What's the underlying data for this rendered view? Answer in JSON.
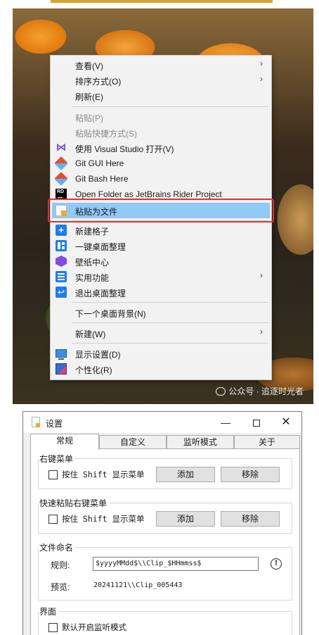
{
  "context_menu": {
    "items": [
      {
        "label": "查看(V)",
        "submenu": true
      },
      {
        "label": "排序方式(O)",
        "submenu": true
      },
      {
        "label": "刷新(E)"
      },
      {
        "label": "粘贴(P)",
        "disabled": true
      },
      {
        "label": "粘贴快捷方式(S)",
        "disabled": true
      },
      {
        "label": "使用 Visual Studio 打开(V)",
        "icon": "visual-studio-icon"
      },
      {
        "label": "Git GUI Here",
        "icon": "git-gui-icon"
      },
      {
        "label": "Git Bash Here",
        "icon": "git-bash-icon"
      },
      {
        "label": "Open Folder as JetBrains Rider Project",
        "icon": "rider-icon"
      },
      {
        "label": "粘贴为文件",
        "icon": "paste-file-icon",
        "highlighted": true
      },
      {
        "label": "新建格子",
        "icon": "add-grid-icon"
      },
      {
        "label": "一键桌面整理",
        "icon": "desktop-organize-icon"
      },
      {
        "label": "壁纸中心",
        "icon": "wallpaper-icon"
      },
      {
        "label": "实用功能",
        "icon": "tools-icon",
        "submenu": true
      },
      {
        "label": "退出桌面整理",
        "icon": "exit-icon"
      },
      {
        "label": "下一个桌面背景(N)"
      },
      {
        "label": "新建(W)",
        "submenu": true
      },
      {
        "label": "显示设置(D)",
        "icon": "display-icon"
      },
      {
        "label": "个性化(R)",
        "icon": "personalize-icon"
      }
    ],
    "arrow_glyph": "›",
    "highlight_color": "#91c9f7",
    "annotation_color": "#e53030"
  },
  "wallpaper": {
    "watermark": "公众号 · 追逐时光者"
  },
  "dialog": {
    "title": "设置",
    "controls": {
      "minimize": "—",
      "close": "✕"
    },
    "tabs": [
      "常规",
      "自定义",
      "监听模式",
      "关于"
    ],
    "groups": {
      "right_menu": {
        "title": "右键菜单",
        "checkbox_label": "按住 Shift 显示菜单",
        "add_button": "添加",
        "remove_button": "移除"
      },
      "quick_paste_menu": {
        "title": "快速粘贴右键菜单",
        "checkbox_label": "按住 Shift 显示菜单",
        "add_button": "添加",
        "remove_button": "移除"
      },
      "file_naming": {
        "title": "文件命名",
        "rule_label": "规则:",
        "rule_value": "$yyyyMMdd$\\\\Clip_$HHmmss$",
        "info_glyph": "!",
        "preview_label": "预览:",
        "preview_value": "20241121\\\\Clip_005443"
      },
      "interface": {
        "title": "界面",
        "checkbox_label": "默认开启监听模式"
      }
    }
  }
}
